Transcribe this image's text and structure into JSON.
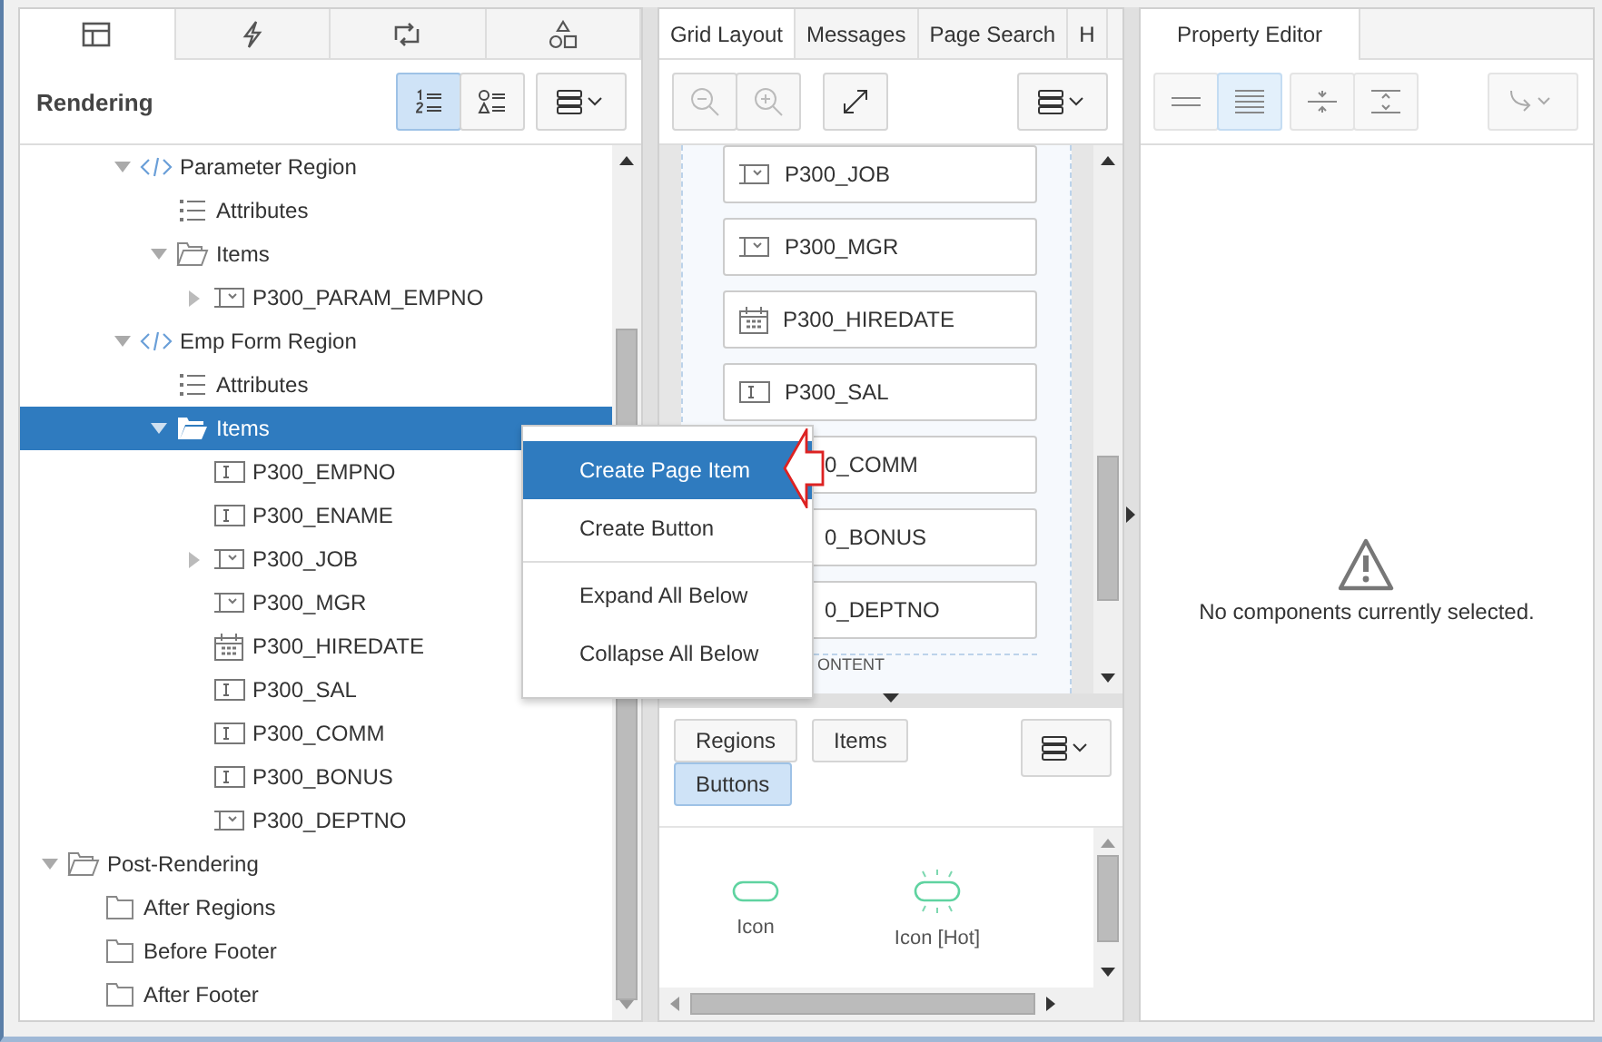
{
  "left_panel": {
    "tabs": [
      {
        "kind": "tree",
        "selected": true
      },
      {
        "kind": "bolt",
        "selected": false
      },
      {
        "kind": "swap",
        "selected": false
      },
      {
        "kind": "shapes",
        "selected": false
      }
    ],
    "title": "Rendering",
    "view_buttons": [
      {
        "kind": "numbered",
        "selected": true
      },
      {
        "kind": "grouped",
        "selected": false
      }
    ],
    "tree": [
      {
        "children": [
          {
            "children": [
              {
                "label": "Parameter Region",
                "kind": "region",
                "expanded": true,
                "selected": false,
                "children": [
                  {
                    "label": "Attributes",
                    "kind": "attributes",
                    "selected": false
                  },
                  {
                    "label": "Items",
                    "kind": "folder",
                    "expanded": true,
                    "selected": false,
                    "children": [
                      {
                        "label": "P300_PARAM_EMPNO",
                        "kind": "select",
                        "expanded": false,
                        "selected": false
                      }
                    ]
                  }
                ]
              },
              {
                "label": "Emp Form Region",
                "kind": "region",
                "expanded": true,
                "selected": false,
                "children": [
                  {
                    "label": "Attributes",
                    "kind": "attributes",
                    "selected": false
                  },
                  {
                    "label": "Items",
                    "kind": "folder",
                    "expanded": true,
                    "selected": true,
                    "children": [
                      {
                        "label": "P300_EMPNO",
                        "kind": "text",
                        "selected": false
                      },
                      {
                        "label": "P300_ENAME",
                        "kind": "text",
                        "selected": false
                      },
                      {
                        "label": "P300_JOB",
                        "kind": "select",
                        "expanded": false,
                        "selected": false
                      },
                      {
                        "label": "P300_MGR",
                        "kind": "select",
                        "selected": false
                      },
                      {
                        "label": "P300_HIREDATE",
                        "kind": "date",
                        "selected": false
                      },
                      {
                        "label": "P300_SAL",
                        "kind": "text",
                        "selected": false
                      },
                      {
                        "label": "P300_COMM",
                        "kind": "text",
                        "selected": false
                      },
                      {
                        "label": "P300_BONUS",
                        "kind": "text",
                        "selected": false
                      },
                      {
                        "label": "P300_DEPTNO",
                        "kind": "select",
                        "selected": false
                      }
                    ]
                  }
                ]
              }
            ]
          }
        ]
      },
      {
        "label": "Post-Rendering",
        "kind": "folder",
        "expanded": true,
        "selected": false,
        "children": [
          {
            "label": "After Regions",
            "kind": "empty-folder",
            "selected": false
          },
          {
            "label": "Before Footer",
            "kind": "empty-folder",
            "selected": false
          },
          {
            "label": "After Footer",
            "kind": "empty-folder",
            "selected": false
          }
        ]
      }
    ]
  },
  "context_menu": {
    "groups": [
      [
        {
          "label": "Create Page Item",
          "selected": true
        },
        {
          "label": "Create Button",
          "selected": false
        }
      ],
      [
        {
          "label": "Expand All Below",
          "selected": false
        },
        {
          "label": "Collapse All Below",
          "selected": false
        }
      ]
    ]
  },
  "middle_panel": {
    "tabs": [
      {
        "label": "Grid Layout",
        "selected": true
      },
      {
        "label": "Messages",
        "selected": false
      },
      {
        "label": "Page Search",
        "selected": false
      },
      {
        "label": "H",
        "selected": false
      }
    ],
    "zoom_buttons": [
      {
        "kind": "zoom-out",
        "disabled": true
      },
      {
        "kind": "zoom-in",
        "disabled": true
      }
    ],
    "grid_items": [
      {
        "label": "P300_JOB",
        "kind": "select"
      },
      {
        "label": "P300_MGR",
        "kind": "select"
      },
      {
        "label": "P300_HIREDATE",
        "kind": "date"
      },
      {
        "label": "P300_SAL",
        "kind": "text"
      },
      {
        "label": "0_COMM",
        "kind": "covered"
      },
      {
        "label": "0_BONUS",
        "kind": "covered"
      },
      {
        "label": "0_DEPTNO",
        "kind": "covered"
      }
    ],
    "region_label": "ONTENT",
    "gallery_filters": [
      {
        "label": "Regions",
        "selected": false
      },
      {
        "label": "Items",
        "selected": false
      },
      {
        "label": "Buttons",
        "selected": true
      }
    ],
    "gallery_items": [
      {
        "label": "Icon",
        "kind": "plain"
      },
      {
        "label": "Icon [Hot]",
        "kind": "hot"
      }
    ]
  },
  "right_panel": {
    "tab": {
      "label": "Property Editor",
      "selected": true
    },
    "view_buttons": [
      {
        "kind": "collapse",
        "selected": false
      },
      {
        "kind": "expand",
        "selected": true
      }
    ],
    "message": "No components currently selected."
  }
}
